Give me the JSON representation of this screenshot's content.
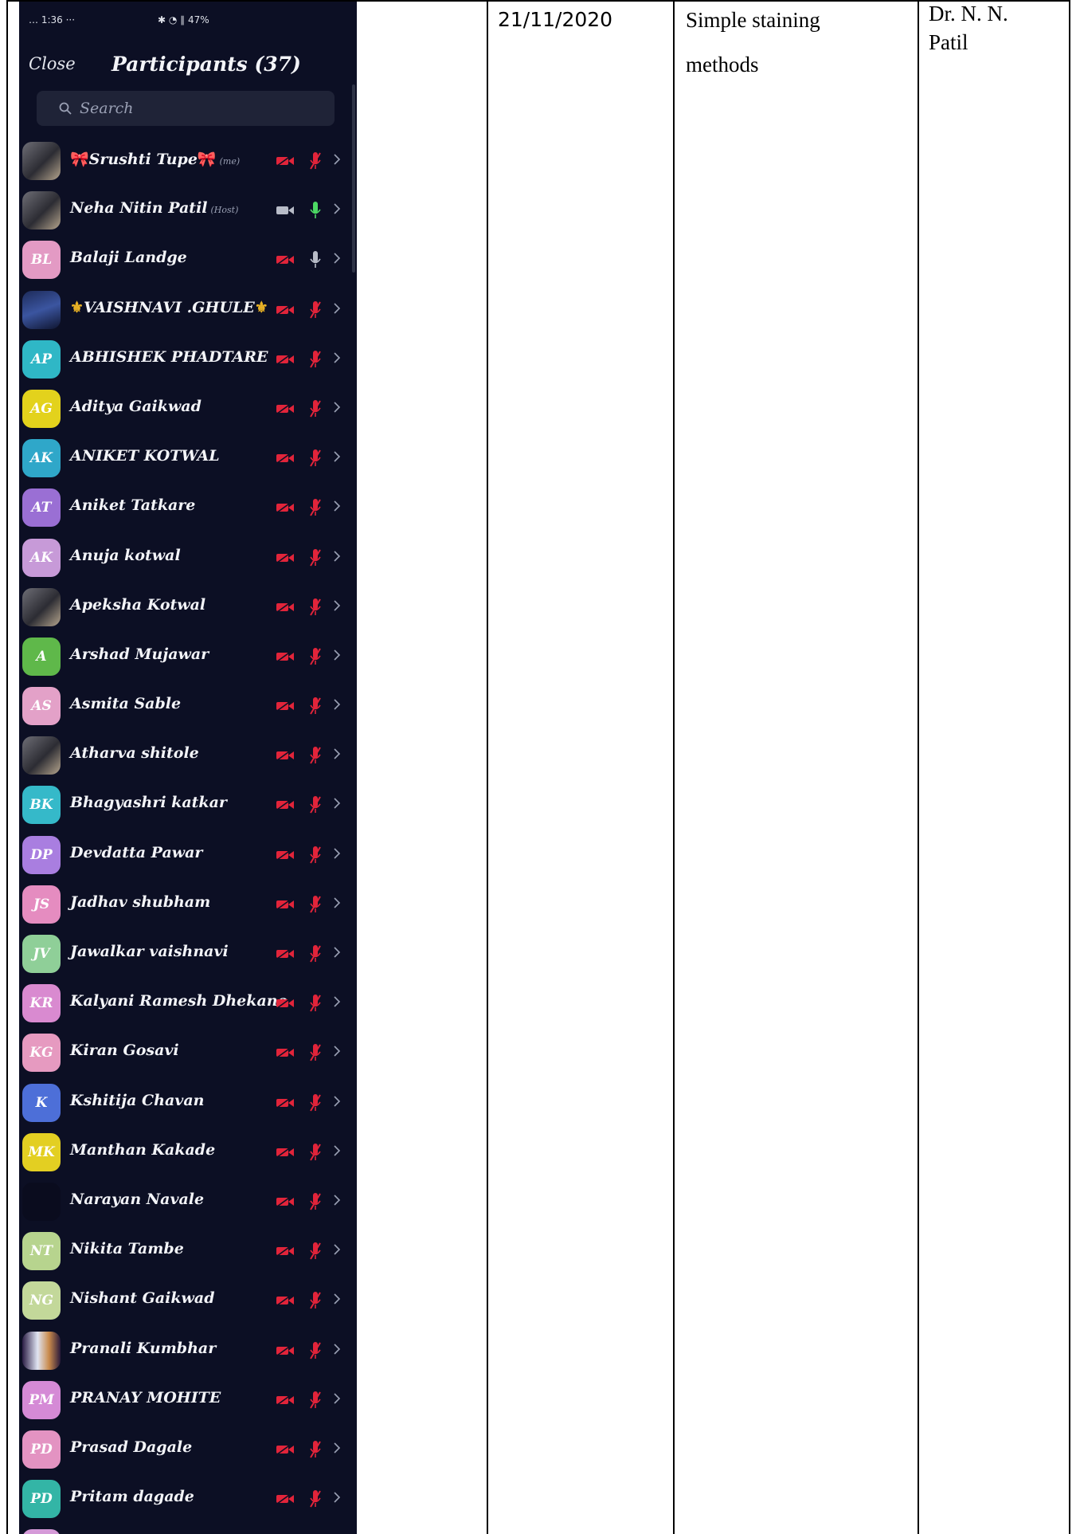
{
  "document": {
    "date": "21/11/2020",
    "topic_line1": "Simple staining",
    "topic_line2": "methods",
    "teacher_line1": "Dr. N. N.",
    "teacher_line2": "Patil"
  },
  "phone": {
    "status_left": "… 1:36 ···",
    "status_right": "✱ ◔ ∥ 47%",
    "close_label": "Close",
    "title": "Participants (37)",
    "search_placeholder": "Search",
    "participants": [
      {
        "name": "Srushti Tupe",
        "tag": "(me)",
        "avatar": "",
        "color": "#3a3a44",
        "kind": "photo",
        "video": "off",
        "mic": "muted",
        "deco": "bow"
      },
      {
        "name": "Neha Nitin Patil",
        "tag": "(Host)",
        "avatar": "",
        "color": "#5a5a5a",
        "kind": "photo",
        "video": "on",
        "mic": "active",
        "deco": ""
      },
      {
        "name": "Balaji Landge",
        "tag": "",
        "avatar": "BL",
        "color": "#e39ac4",
        "kind": "initials",
        "video": "off",
        "mic": "idle",
        "deco": ""
      },
      {
        "name": "VAISHNAVI .GHULE",
        "tag": "",
        "avatar": "",
        "color": "#2a3a70",
        "kind": "photo2",
        "video": "off",
        "mic": "muted",
        "deco": "fleur"
      },
      {
        "name": "ABHISHEK PHADTARE",
        "tag": "",
        "avatar": "AP",
        "color": "#2fb7c6",
        "kind": "initials",
        "video": "off",
        "mic": "muted",
        "deco": ""
      },
      {
        "name": "Aditya Gaikwad",
        "tag": "",
        "avatar": "AG",
        "color": "#e3d21c",
        "kind": "initials",
        "video": "off",
        "mic": "muted",
        "deco": ""
      },
      {
        "name": "ANIKET KOTWAL",
        "tag": "",
        "avatar": "AK",
        "color": "#2fa7c9",
        "kind": "initials",
        "video": "off",
        "mic": "muted",
        "deco": ""
      },
      {
        "name": "Aniket Tatkare",
        "tag": "",
        "avatar": "AT",
        "color": "#9a6fd4",
        "kind": "initials",
        "video": "off",
        "mic": "muted",
        "deco": ""
      },
      {
        "name": "Anuja kotwal",
        "tag": "",
        "avatar": "AK",
        "color": "#c79ad8",
        "kind": "initials",
        "video": "off",
        "mic": "muted",
        "deco": ""
      },
      {
        "name": "Apeksha Kotwal",
        "tag": "",
        "avatar": "",
        "color": "#3a3030",
        "kind": "photo",
        "video": "off",
        "mic": "muted",
        "deco": ""
      },
      {
        "name": "Arshad Mujawar",
        "tag": "",
        "avatar": "A",
        "color": "#5fb84a",
        "kind": "initials",
        "video": "off",
        "mic": "muted",
        "deco": ""
      },
      {
        "name": "Asmita Sable",
        "tag": "",
        "avatar": "AS",
        "color": "#e3a1c8",
        "kind": "initials",
        "video": "off",
        "mic": "muted",
        "deco": ""
      },
      {
        "name": "Atharva shitole",
        "tag": "",
        "avatar": "",
        "color": "#6a6a6a",
        "kind": "photo",
        "video": "off",
        "mic": "muted",
        "deco": ""
      },
      {
        "name": "Bhagyashri katkar",
        "tag": "",
        "avatar": "BK",
        "color": "#35b9c9",
        "kind": "initials",
        "video": "off",
        "mic": "muted",
        "deco": ""
      },
      {
        "name": "Devdatta Pawar",
        "tag": "",
        "avatar": "DP",
        "color": "#a97ee0",
        "kind": "initials",
        "video": "off",
        "mic": "muted",
        "deco": ""
      },
      {
        "name": "Jadhav shubham",
        "tag": "",
        "avatar": "JS",
        "color": "#e58cc0",
        "kind": "initials",
        "video": "off",
        "mic": "muted",
        "deco": ""
      },
      {
        "name": "Jawalkar vaishnavi",
        "tag": "",
        "avatar": "JV",
        "color": "#8fcf98",
        "kind": "initials",
        "video": "off",
        "mic": "muted",
        "deco": ""
      },
      {
        "name": "Kalyani Ramesh Dhekane",
        "tag": "",
        "avatar": "KR",
        "color": "#d98ad0",
        "kind": "initials",
        "video": "off",
        "mic": "muted",
        "deco": ""
      },
      {
        "name": "Kiran Gosavi",
        "tag": "",
        "avatar": "KG",
        "color": "#e69ac0",
        "kind": "initials",
        "video": "off",
        "mic": "muted",
        "deco": ""
      },
      {
        "name": "Kshitija Chavan",
        "tag": "",
        "avatar": "K",
        "color": "#4d6fd8",
        "kind": "initials",
        "video": "off",
        "mic": "muted",
        "deco": ""
      },
      {
        "name": "Manthan Kakade",
        "tag": "",
        "avatar": "MK",
        "color": "#e3cf22",
        "kind": "initials",
        "video": "off",
        "mic": "muted",
        "deco": ""
      },
      {
        "name": "Narayan Navale",
        "tag": "",
        "avatar": "",
        "color": "#0a0c1e",
        "kind": "initials",
        "video": "off",
        "mic": "muted",
        "deco": ""
      },
      {
        "name": "Nikita Tambe",
        "tag": "",
        "avatar": "NT",
        "color": "#b7d48e",
        "kind": "initials",
        "video": "off",
        "mic": "muted",
        "deco": ""
      },
      {
        "name": "Nishant Gaikwad",
        "tag": "",
        "avatar": "NG",
        "color": "#c3d89a",
        "kind": "initials",
        "video": "off",
        "mic": "muted",
        "deco": ""
      },
      {
        "name": "Pranali Kumbhar",
        "tag": "",
        "avatar": "",
        "color": "#6a4aa0",
        "kind": "photo3",
        "video": "off",
        "mic": "muted",
        "deco": ""
      },
      {
        "name": "PRANAY MOHITE",
        "tag": "",
        "avatar": "PM",
        "color": "#d58ad6",
        "kind": "initials",
        "video": "off",
        "mic": "muted",
        "deco": ""
      },
      {
        "name": "Prasad Dagale",
        "tag": "",
        "avatar": "PD",
        "color": "#e393c2",
        "kind": "initials",
        "video": "off",
        "mic": "muted",
        "deco": ""
      },
      {
        "name": "Pritam dagade",
        "tag": "",
        "avatar": "PD",
        "color": "#33b5a6",
        "kind": "initials",
        "video": "off",
        "mic": "muted",
        "deco": ""
      },
      {
        "name": "",
        "tag": "",
        "avatar": "",
        "color": "#d59ad8",
        "kind": "initials",
        "video": "off",
        "mic": "muted",
        "deco": ""
      }
    ]
  },
  "colors": {
    "phone_bg": "#0c0f24",
    "muted_red": "#e2243a",
    "active_green": "#4cd964",
    "idle_grey": "#b8bcc8"
  }
}
